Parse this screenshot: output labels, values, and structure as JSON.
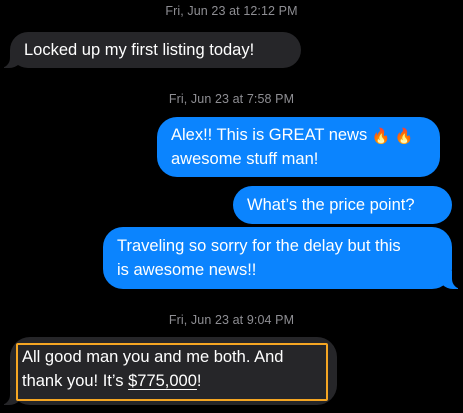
{
  "timestamps": [
    {
      "day": "Fri, Jun 23",
      "at": "at",
      "time": "12:12 PM"
    },
    {
      "day": "Fri, Jun 23",
      "at": "at",
      "time": "7:58 PM"
    },
    {
      "day": "Fri, Jun 23",
      "at": "at",
      "time": "9:04 PM"
    }
  ],
  "messages": [
    {
      "direction": "incoming",
      "text": "Locked up my first listing today!"
    },
    {
      "direction": "outgoing",
      "line1": "Alex!! This is GREAT news",
      "emoji": "🔥 🔥",
      "line2": "awesome stuff man!"
    },
    {
      "direction": "outgoing",
      "text": "What’s the price point?"
    },
    {
      "direction": "outgoing",
      "line1": "Traveling so sorry for the delay but this",
      "line2": "is awesome news!!"
    },
    {
      "direction": "incoming",
      "line1": "All good man you and me both. And",
      "line2_prefix": "thank you! It’s ",
      "price": "$775,000",
      "line2_suffix": "!"
    }
  ],
  "colors": {
    "background": "#000000",
    "incoming_bubble": "#262629",
    "outgoing_bubble": "#0b84fe",
    "timestamp_text": "#8e8e93",
    "highlight": "#f5a623"
  },
  "icons": {
    "emoji": "fire-emoji"
  }
}
